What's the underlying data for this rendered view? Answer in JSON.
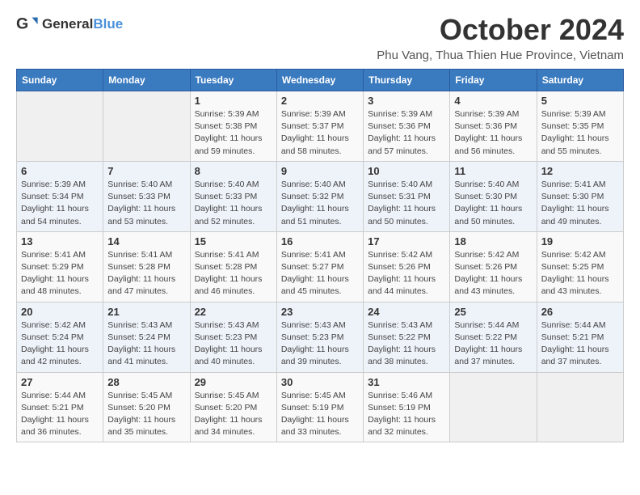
{
  "logo": {
    "general": "General",
    "blue": "Blue"
  },
  "header": {
    "month": "October 2024",
    "location": "Phu Vang, Thua Thien Hue Province, Vietnam"
  },
  "weekdays": [
    "Sunday",
    "Monday",
    "Tuesday",
    "Wednesday",
    "Thursday",
    "Friday",
    "Saturday"
  ],
  "weeks": [
    [
      {
        "day": "",
        "info": ""
      },
      {
        "day": "",
        "info": ""
      },
      {
        "day": "1",
        "info": "Sunrise: 5:39 AM\nSunset: 5:38 PM\nDaylight: 11 hours and 59 minutes."
      },
      {
        "day": "2",
        "info": "Sunrise: 5:39 AM\nSunset: 5:37 PM\nDaylight: 11 hours and 58 minutes."
      },
      {
        "day": "3",
        "info": "Sunrise: 5:39 AM\nSunset: 5:36 PM\nDaylight: 11 hours and 57 minutes."
      },
      {
        "day": "4",
        "info": "Sunrise: 5:39 AM\nSunset: 5:36 PM\nDaylight: 11 hours and 56 minutes."
      },
      {
        "day": "5",
        "info": "Sunrise: 5:39 AM\nSunset: 5:35 PM\nDaylight: 11 hours and 55 minutes."
      }
    ],
    [
      {
        "day": "6",
        "info": "Sunrise: 5:39 AM\nSunset: 5:34 PM\nDaylight: 11 hours and 54 minutes."
      },
      {
        "day": "7",
        "info": "Sunrise: 5:40 AM\nSunset: 5:33 PM\nDaylight: 11 hours and 53 minutes."
      },
      {
        "day": "8",
        "info": "Sunrise: 5:40 AM\nSunset: 5:33 PM\nDaylight: 11 hours and 52 minutes."
      },
      {
        "day": "9",
        "info": "Sunrise: 5:40 AM\nSunset: 5:32 PM\nDaylight: 11 hours and 51 minutes."
      },
      {
        "day": "10",
        "info": "Sunrise: 5:40 AM\nSunset: 5:31 PM\nDaylight: 11 hours and 50 minutes."
      },
      {
        "day": "11",
        "info": "Sunrise: 5:40 AM\nSunset: 5:30 PM\nDaylight: 11 hours and 50 minutes."
      },
      {
        "day": "12",
        "info": "Sunrise: 5:41 AM\nSunset: 5:30 PM\nDaylight: 11 hours and 49 minutes."
      }
    ],
    [
      {
        "day": "13",
        "info": "Sunrise: 5:41 AM\nSunset: 5:29 PM\nDaylight: 11 hours and 48 minutes."
      },
      {
        "day": "14",
        "info": "Sunrise: 5:41 AM\nSunset: 5:28 PM\nDaylight: 11 hours and 47 minutes."
      },
      {
        "day": "15",
        "info": "Sunrise: 5:41 AM\nSunset: 5:28 PM\nDaylight: 11 hours and 46 minutes."
      },
      {
        "day": "16",
        "info": "Sunrise: 5:41 AM\nSunset: 5:27 PM\nDaylight: 11 hours and 45 minutes."
      },
      {
        "day": "17",
        "info": "Sunrise: 5:42 AM\nSunset: 5:26 PM\nDaylight: 11 hours and 44 minutes."
      },
      {
        "day": "18",
        "info": "Sunrise: 5:42 AM\nSunset: 5:26 PM\nDaylight: 11 hours and 43 minutes."
      },
      {
        "day": "19",
        "info": "Sunrise: 5:42 AM\nSunset: 5:25 PM\nDaylight: 11 hours and 43 minutes."
      }
    ],
    [
      {
        "day": "20",
        "info": "Sunrise: 5:42 AM\nSunset: 5:24 PM\nDaylight: 11 hours and 42 minutes."
      },
      {
        "day": "21",
        "info": "Sunrise: 5:43 AM\nSunset: 5:24 PM\nDaylight: 11 hours and 41 minutes."
      },
      {
        "day": "22",
        "info": "Sunrise: 5:43 AM\nSunset: 5:23 PM\nDaylight: 11 hours and 40 minutes."
      },
      {
        "day": "23",
        "info": "Sunrise: 5:43 AM\nSunset: 5:23 PM\nDaylight: 11 hours and 39 minutes."
      },
      {
        "day": "24",
        "info": "Sunrise: 5:43 AM\nSunset: 5:22 PM\nDaylight: 11 hours and 38 minutes."
      },
      {
        "day": "25",
        "info": "Sunrise: 5:44 AM\nSunset: 5:22 PM\nDaylight: 11 hours and 37 minutes."
      },
      {
        "day": "26",
        "info": "Sunrise: 5:44 AM\nSunset: 5:21 PM\nDaylight: 11 hours and 37 minutes."
      }
    ],
    [
      {
        "day": "27",
        "info": "Sunrise: 5:44 AM\nSunset: 5:21 PM\nDaylight: 11 hours and 36 minutes."
      },
      {
        "day": "28",
        "info": "Sunrise: 5:45 AM\nSunset: 5:20 PM\nDaylight: 11 hours and 35 minutes."
      },
      {
        "day": "29",
        "info": "Sunrise: 5:45 AM\nSunset: 5:20 PM\nDaylight: 11 hours and 34 minutes."
      },
      {
        "day": "30",
        "info": "Sunrise: 5:45 AM\nSunset: 5:19 PM\nDaylight: 11 hours and 33 minutes."
      },
      {
        "day": "31",
        "info": "Sunrise: 5:46 AM\nSunset: 5:19 PM\nDaylight: 11 hours and 32 minutes."
      },
      {
        "day": "",
        "info": ""
      },
      {
        "day": "",
        "info": ""
      }
    ]
  ]
}
